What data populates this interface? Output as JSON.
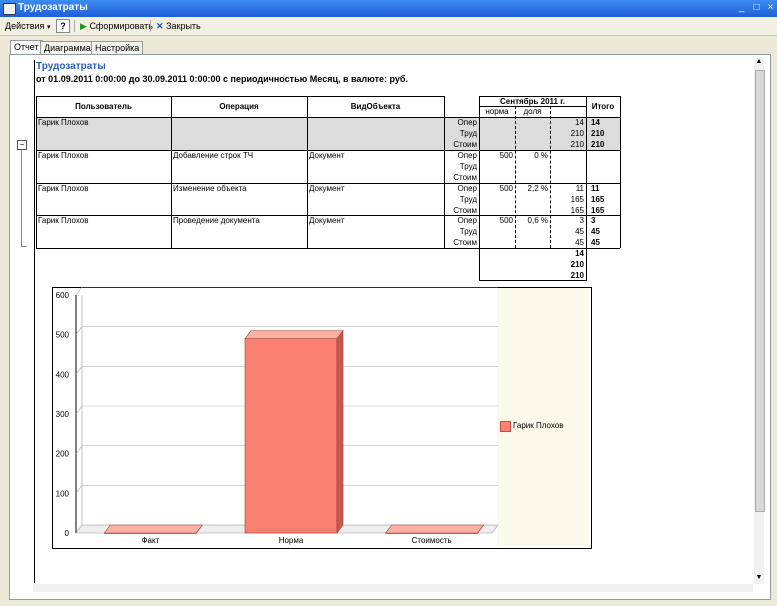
{
  "window": {
    "title": "Трудозатраты"
  },
  "toolbar": {
    "actions": "Действия",
    "help": "?",
    "run": "Сформировать",
    "close": "Закрыть"
  },
  "tabs": [
    "Отчет",
    "Диаграмма",
    "Настройка"
  ],
  "report": {
    "title": "Трудозатраты",
    "subtitle": "от 01.09.2011 0:00:00 до 30.09.2011 0:00:00 с периодичностью Месяц, в валюте: руб.",
    "columns": {
      "user": "Пользователь",
      "operation": "Операция",
      "object": "ВидОбъекта",
      "period": "Сентябрь 2011 г.",
      "norm": "норма",
      "share": "доля",
      "total": "Итого"
    },
    "metrics": [
      "Опер",
      "Труд",
      "Стоим"
    ],
    "group": {
      "user": "Гарик Плохов",
      "values": [
        "14",
        "210",
        "210"
      ],
      "totals": [
        "14",
        "210",
        "210"
      ]
    },
    "rows": [
      {
        "user": "Гарик Плохов",
        "operation": "Добавление строк ТЧ",
        "object": "Документ",
        "norm": "500",
        "share": "0 %",
        "values": [
          "",
          "",
          ""
        ],
        "totals": [
          "",
          "",
          ""
        ]
      },
      {
        "user": "Гарик Плохов",
        "operation": "Изменение объекта",
        "object": "Документ",
        "norm": "500",
        "share": "2,2 %",
        "values": [
          "11",
          "165",
          "165"
        ],
        "totals": [
          "11",
          "165",
          "165"
        ]
      },
      {
        "user": "Гарик Плохов",
        "operation": "Проведение документа",
        "object": "Документ",
        "norm": "500",
        "share": "0,6 %",
        "values": [
          "3",
          "45",
          "45"
        ],
        "totals": [
          "3",
          "45",
          "45"
        ]
      }
    ],
    "grand_totals": [
      "14",
      "210",
      "210"
    ]
  },
  "chart_data": {
    "type": "bar",
    "categories": [
      "Факт",
      "Норма",
      "Стоимость"
    ],
    "series": [
      {
        "name": "Гарик Плохов",
        "values": [
          0,
          490,
          0
        ],
        "color": "#fa8072"
      }
    ],
    "yticks": [
      "0",
      "100",
      "200",
      "300",
      "400",
      "500",
      "600"
    ],
    "ylim": [
      0,
      600
    ],
    "grid": true,
    "legend": "right",
    "title": "",
    "xlabel": "",
    "ylabel": ""
  }
}
